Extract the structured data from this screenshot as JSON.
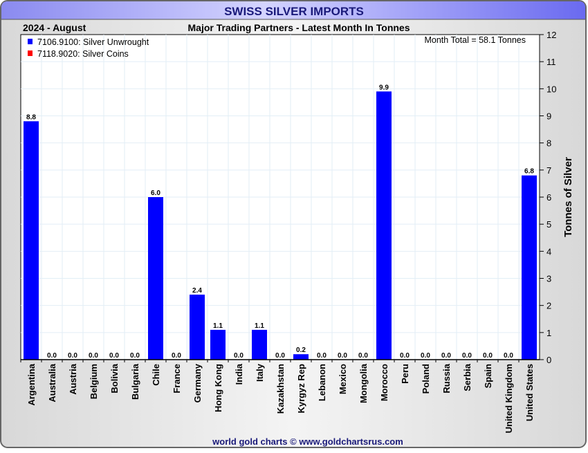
{
  "chart_data": {
    "type": "bar",
    "title": "SWISS SILVER IMPORTS",
    "period": "2024 - August",
    "subtitle": "Major Trading Partners - Latest Month In Tonnes",
    "annotation": "Month Total = 58.1 Tonnes",
    "ylabel": "Tonnes of Silver",
    "xlabel": "",
    "ylim": [
      0,
      12
    ],
    "yticks": [
      0,
      1,
      2,
      3,
      4,
      5,
      6,
      7,
      8,
      9,
      10,
      11,
      12
    ],
    "grid": true,
    "legend_position": "top-left",
    "legend": [
      {
        "label": "7106.9100: Silver Unwrought",
        "color": "#0000ff"
      },
      {
        "label": "7118.9020: Silver Coins",
        "color": "#ff0000"
      }
    ],
    "categories": [
      "Argentina",
      "Australia",
      "Austria",
      "Belgium",
      "Bolivia",
      "Bulgaria",
      "Chile",
      "France",
      "Germany",
      "Hong Kong",
      "India",
      "Italy",
      "Kazakhstan",
      "Kyrgyz Rep",
      "Lebanon",
      "Mexico",
      "Mongolia",
      "Morocco",
      "Peru",
      "Poland",
      "Russia",
      "Serbia",
      "Spain",
      "United Kingdom",
      "United States"
    ],
    "series": [
      {
        "name": "7106.9100: Silver Unwrought",
        "color": "#0000ff",
        "values": [
          8.8,
          0.0,
          0.0,
          0.0,
          0.0,
          0.0,
          6.0,
          0.0,
          2.4,
          1.1,
          0.0,
          1.1,
          0.0,
          0.2,
          0.0,
          0.0,
          0.0,
          9.9,
          0.0,
          0.0,
          0.0,
          0.0,
          0.0,
          0.0,
          6.8
        ]
      },
      {
        "name": "7118.9020: Silver Coins",
        "color": "#ff0000",
        "values": [
          0,
          0,
          0,
          0,
          0,
          0,
          0,
          0,
          0,
          0,
          0,
          0,
          0,
          0,
          0,
          0,
          0,
          0,
          0,
          0,
          0,
          0,
          0,
          0,
          0
        ]
      }
    ],
    "data_labels": [
      "8.8",
      "0.0",
      "0.0",
      "0.0",
      "0.0",
      "0.0",
      "6.0",
      "0.0",
      "2.4",
      "1.1",
      "0.0",
      "1.1",
      "0.0",
      "0.2",
      "0.0",
      "0.0",
      "0.0",
      "9.9",
      "0.0",
      "0.0",
      "0.0",
      "0.0",
      "0.0",
      "0.0",
      "6.8"
    ]
  },
  "footer": "world gold charts © www.goldchartsrus.com"
}
